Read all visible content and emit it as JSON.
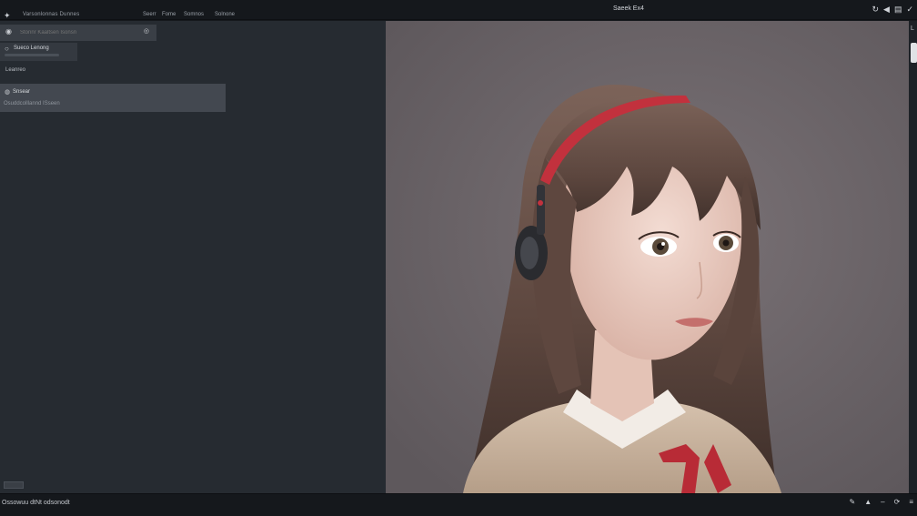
{
  "header": {
    "app_name": "Varsonlonnas Dunnes",
    "menu": [
      "Seerr",
      "Fome",
      "Somnos",
      "Solnone"
    ],
    "window_title": "Saeek Ex4",
    "icons": [
      "refresh-icon",
      "send-icon",
      "document-icon",
      "check-icon"
    ]
  },
  "sidebar": {
    "search": {
      "placeholder": "Stonnr Kaaltsen Isonsn",
      "value": ""
    },
    "chip": {
      "label": "Sueco Lenong"
    },
    "section_label": "Leanreo",
    "card": {
      "title": "Snsear",
      "subtitle": "Osuddcolllannd ISseen"
    }
  },
  "viewer": {
    "subject": "girl-with-headphones"
  },
  "statusbar": {
    "text": "Ossowuu dtNt odsonodt",
    "icons": [
      "pen-icon",
      "pin-icon",
      "dash-icon",
      "refresh-icon",
      "menu-icon"
    ]
  },
  "colors": {
    "panel": "#262b31",
    "background": "#6d666a",
    "accent_red": "#c2313d"
  }
}
